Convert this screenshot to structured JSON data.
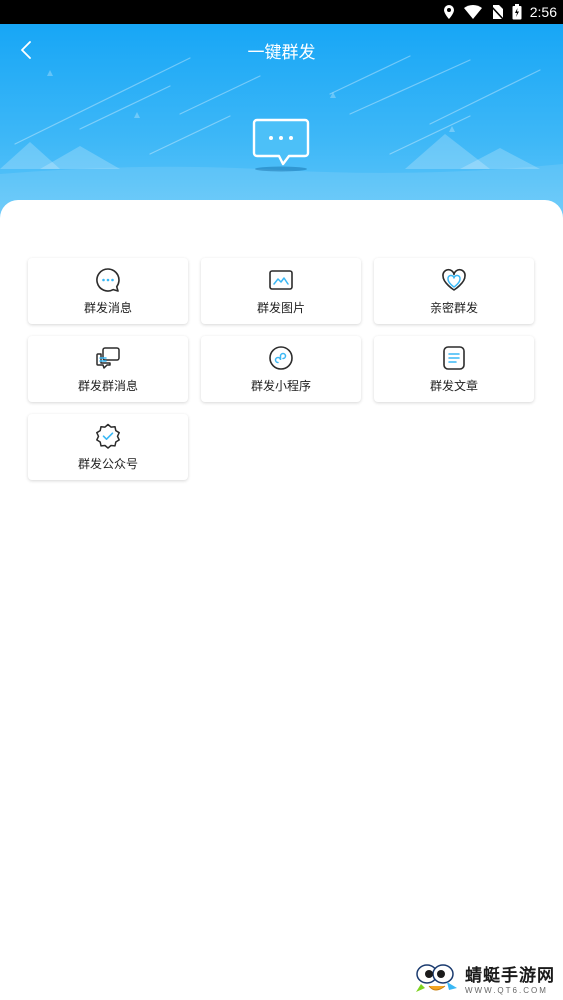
{
  "status_bar": {
    "time": "2:56",
    "icons": [
      "location-icon",
      "wifi-icon",
      "no-sim-icon",
      "battery-icon"
    ]
  },
  "header": {
    "title": "一键群发",
    "back_icon": "chevron-left-icon",
    "hero_icon": "chat-bubble-icon"
  },
  "features": [
    {
      "label": "群发消息",
      "icon": "chat-dots-icon"
    },
    {
      "label": "群发图片",
      "icon": "image-icon"
    },
    {
      "label": "亲密群发",
      "icon": "heart-icon"
    },
    {
      "label": "群发群消息",
      "icon": "group-chat-icon"
    },
    {
      "label": "群发小程序",
      "icon": "mini-program-icon"
    },
    {
      "label": "群发文章",
      "icon": "article-icon"
    },
    {
      "label": "群发公众号",
      "icon": "official-account-icon"
    }
  ],
  "watermark": {
    "name": "蜻蜓手游网",
    "url": "WWW.QT6.COM"
  },
  "colors": {
    "header_top": "#17a6f6",
    "header_bottom": "#6ccbfa",
    "icon_stroke": "#2c2c2c",
    "icon_accent": "#3ab8f5"
  }
}
